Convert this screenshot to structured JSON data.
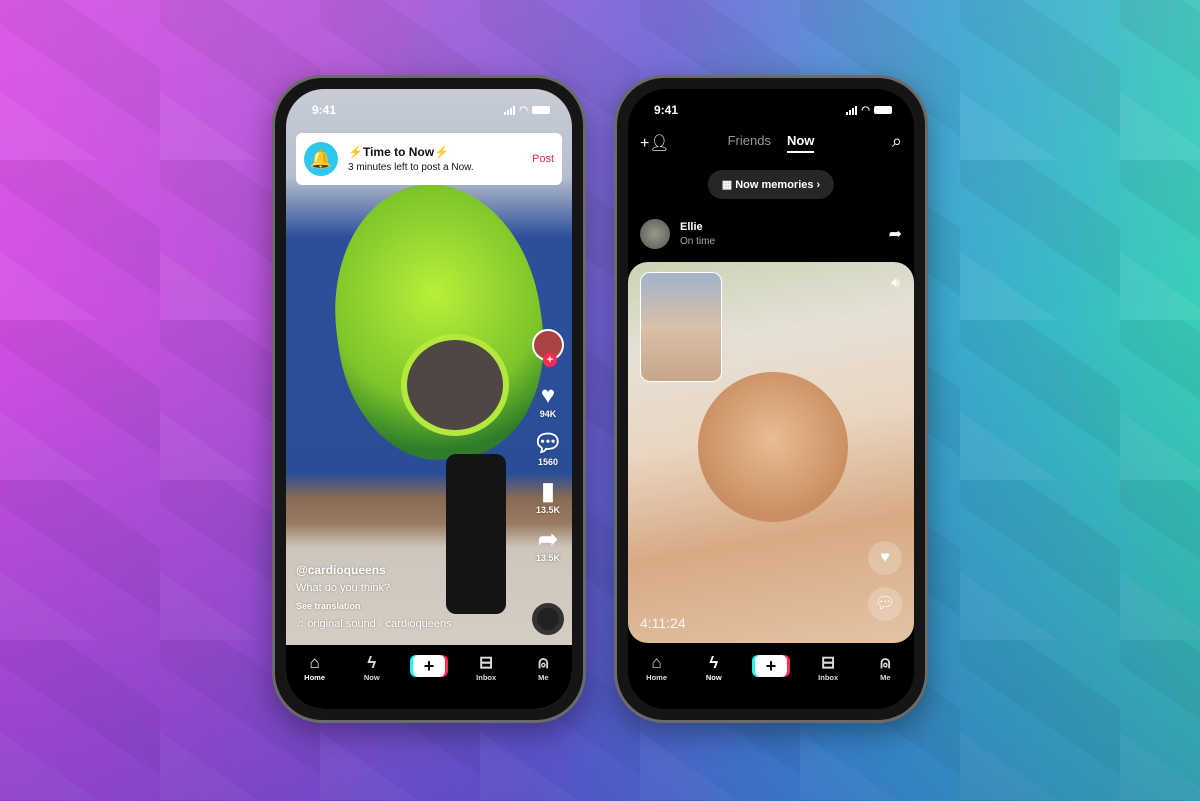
{
  "phone_left": {
    "status_time": "9:41",
    "notification": {
      "title": "Time to Now",
      "subtitle": "3 minutes left to post a Now.",
      "action": "Post",
      "bolt": "⚡"
    },
    "actions": {
      "likes": "94K",
      "comments": "1560",
      "saves": "13.5K",
      "shares": "13.5K"
    },
    "caption": {
      "user": "@cardioqueens",
      "text": "What do you think?",
      "see_translation": "See translation",
      "sound": "original sound - cardioqueens"
    },
    "nav": [
      {
        "label": "Home",
        "icon": "⌂"
      },
      {
        "label": "Now",
        "icon": "ϟ"
      },
      {
        "label": "",
        "icon": "+"
      },
      {
        "label": "Inbox",
        "icon": "⊟"
      },
      {
        "label": "Me",
        "icon": "⍝"
      }
    ],
    "active_tab": "Home"
  },
  "phone_right": {
    "status_time": "9:41",
    "tabs": [
      "Friends",
      "Now"
    ],
    "active_tab": "Now",
    "memories_button": "Now memories",
    "friend": {
      "name": "Ellie",
      "status": "On time"
    },
    "timestamp": "4:11:24",
    "nav": [
      {
        "label": "Home",
        "icon": "⌂"
      },
      {
        "label": "Now",
        "icon": "ϟ"
      },
      {
        "label": "",
        "icon": "+"
      },
      {
        "label": "Inbox",
        "icon": "⊟"
      },
      {
        "label": "Me",
        "icon": "⍝"
      }
    ],
    "active_nav": "Now"
  },
  "colors": {
    "accent_red": "#fe2c55",
    "accent_cyan": "#25f4ee",
    "post_red": "#e5304a"
  }
}
